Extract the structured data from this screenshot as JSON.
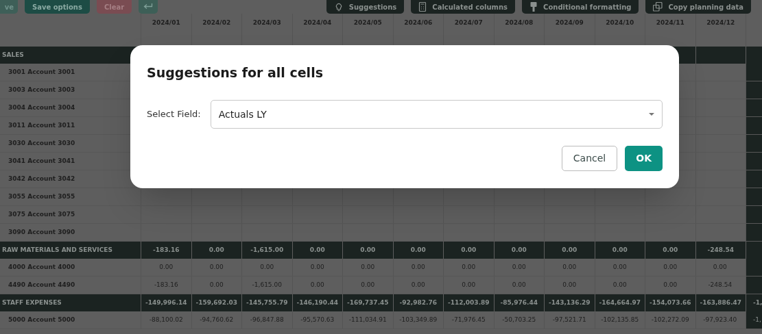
{
  "toolbar": {
    "left_buttons": [
      {
        "kind": "faded",
        "label": "ve"
      },
      {
        "kind": "primary",
        "label": "Save options"
      },
      {
        "kind": "danger",
        "label": "Clear"
      },
      {
        "kind": "icon"
      }
    ],
    "right_buttons": [
      {
        "label": "Suggestions"
      },
      {
        "label": "Calculated columns"
      },
      {
        "label": "Conditional formatting"
      },
      {
        "label": "Copy planning data"
      }
    ]
  },
  "table": {
    "columns": [
      "2024/01",
      "2024/02",
      "2024/03",
      "2024/04",
      "2024/05",
      "2024/06",
      "2024/07",
      "2024/08",
      "2024/09",
      "2024/10",
      "2024/11",
      "2024/12"
    ],
    "rows": [
      {
        "kind": "group",
        "label": "SALES",
        "values": []
      },
      {
        "kind": "account",
        "label": "3001 Account 3001",
        "values": []
      },
      {
        "kind": "account",
        "label": "3003 Account 3003",
        "values": []
      },
      {
        "kind": "account",
        "label": "3004 Account 3004",
        "values": []
      },
      {
        "kind": "account",
        "label": "3011 Account 3011",
        "values": []
      },
      {
        "kind": "account",
        "label": "3030 Account 3030",
        "values": []
      },
      {
        "kind": "account",
        "label": "3041 Account 3041",
        "values": []
      },
      {
        "kind": "account",
        "label": "3042 Account 3042",
        "values": []
      },
      {
        "kind": "account",
        "label": "3055 Account 3055",
        "values": []
      },
      {
        "kind": "account",
        "label": "3075 Account 3075",
        "values": []
      },
      {
        "kind": "account",
        "label": "3090 Account 3090",
        "values": []
      },
      {
        "kind": "group",
        "label": "RAW MATERIALS AND SERVICES",
        "values": [
          "-183.16",
          "0.00",
          "-1,615.00",
          "0.00",
          "0.00",
          "0.00",
          "0.00",
          "0.00",
          "0.00",
          "0.00",
          "0.00",
          "-248.54"
        ]
      },
      {
        "kind": "account",
        "label": "4000 Account 4000",
        "values": [
          "0.00",
          "0.00",
          "0.00",
          "0.00",
          "0.00",
          "0.00",
          "0.00",
          "0.00",
          "0.00",
          "0.00",
          "0.00",
          "0.00"
        ]
      },
      {
        "kind": "account",
        "label": "4490 Account 4490",
        "values": [
          "-183.16",
          "0.00",
          "-1,615.00",
          "0.00",
          "0.00",
          "0.00",
          "0.00",
          "0.00",
          "0.00",
          "0.00",
          "0.00",
          "-248.54"
        ]
      },
      {
        "kind": "group",
        "label": "STAFF EXPENSES",
        "values": [
          "-149,996.14",
          "-159,692.03",
          "-145,755.79",
          "-146,190.44",
          "-169,737.45",
          "-92,982.76",
          "-112,003.89",
          "-85,976.44",
          "-143,136.29",
          "-164,664.97",
          "-154,073.66",
          "-163,886.47",
          "-1,"
        ]
      },
      {
        "kind": "account",
        "label": "5000 Account 5000",
        "values": [
          "-88,100.02",
          "-94,760.62",
          "-96,847.88",
          "-95,570.63",
          "-111,034.91",
          "-103,349.89",
          "-71,976.45",
          "-50,703.25",
          "-97,521.71",
          "-102,135.85",
          "-102,272.09",
          "-97,923.40",
          "-1,"
        ]
      }
    ]
  },
  "dialog": {
    "title": "Suggestions for all cells",
    "field_label": "Select Field:",
    "select_value": "Actuals LY",
    "buttons": [
      {
        "kind": "secondary",
        "label": "Cancel"
      },
      {
        "kind": "primary",
        "label": "OK"
      }
    ]
  }
}
